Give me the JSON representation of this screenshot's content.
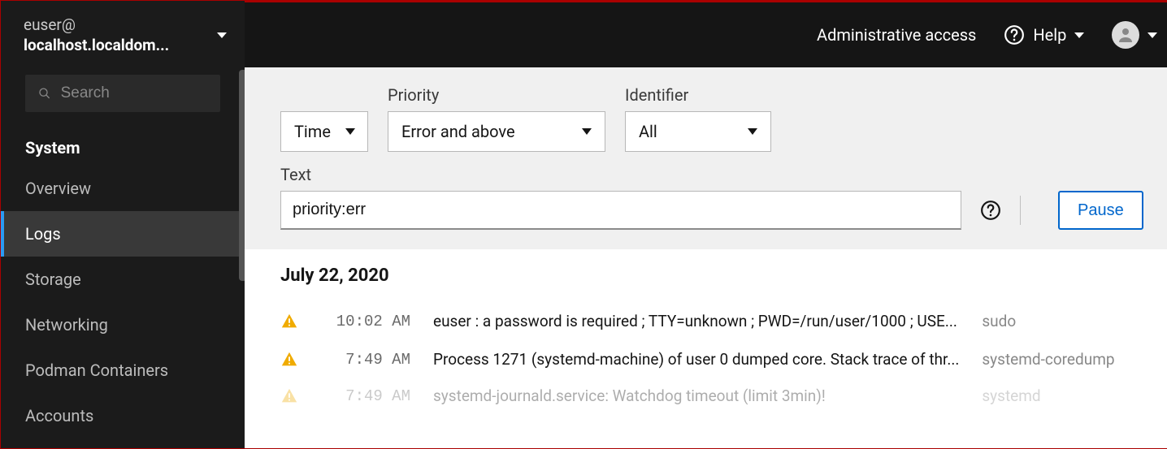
{
  "host": {
    "user": "euser@",
    "name": "localhost.localdom..."
  },
  "search": {
    "placeholder": "Search"
  },
  "nav": {
    "heading": "System",
    "items": [
      {
        "label": "Overview",
        "active": false
      },
      {
        "label": "Logs",
        "active": true
      },
      {
        "label": "Storage",
        "active": false
      },
      {
        "label": "Networking",
        "active": false
      },
      {
        "label": "Podman Containers",
        "active": false
      },
      {
        "label": "Accounts",
        "active": false
      }
    ]
  },
  "topbar": {
    "admin": "Administrative access",
    "help": "Help"
  },
  "filters": {
    "time_label": "Time",
    "priority_label": "Priority",
    "priority_value": "Error and above",
    "identifier_label": "Identifier",
    "identifier_value": "All",
    "text_label": "Text",
    "text_value": "priority:err",
    "pause_label": "Pause"
  },
  "logs": {
    "date": "July 22, 2020",
    "entries": [
      {
        "time": "10:02 AM",
        "msg": "euser : a password is required ; TTY=unknown ; PWD=/run/user/1000 ; USE...",
        "src": "sudo"
      },
      {
        "time": "7:49 AM",
        "msg": "Process 1271 (systemd-machine) of user 0 dumped core. Stack trace of thr...",
        "src": "systemd-coredump"
      },
      {
        "time": "7:49 AM",
        "msg": "systemd-journald.service: Watchdog timeout (limit 3min)!",
        "src": "systemd"
      }
    ]
  }
}
